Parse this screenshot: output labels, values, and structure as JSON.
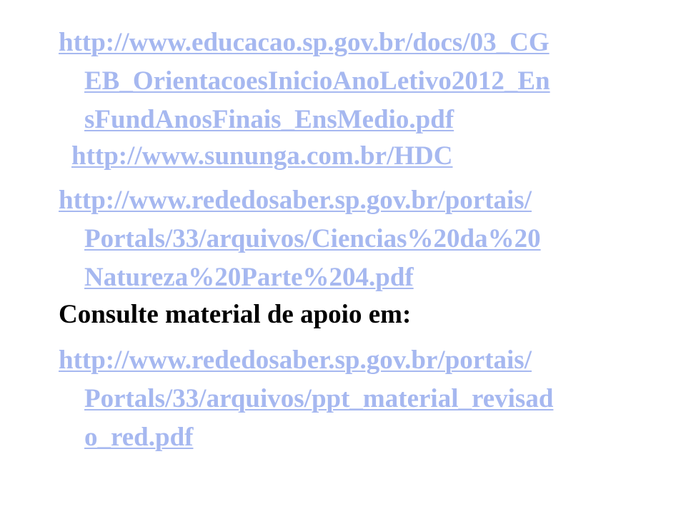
{
  "links": {
    "link1": {
      "lines": [
        "http://www.educacao.sp.gov.br/docs/03_CG",
        "EB_OrientacoesInicioAnoLetivo2012_En",
        "sFundAnosFinais_EnsMedio.pdf"
      ]
    },
    "link2": {
      "lines": [
        "http://www.sununga.com.br/HDC"
      ]
    },
    "link3": {
      "lines": [
        "http://www.rededosaber.sp.gov.br/portais/",
        "Portals/33/arquivos/Ciencias%20da%20",
        "Natureza%20Parte%204.pdf"
      ]
    },
    "heading": "Consulte material de apoio em:",
    "link4": {
      "lines": [
        "http://www.rededosaber.sp.gov.br/portais/",
        "Portals/33/arquivos/ppt_material_revisad",
        "o_red.pdf"
      ]
    }
  },
  "colors": {
    "link": "#a6b8f0",
    "text": "#000000",
    "background": "#ffffff"
  }
}
